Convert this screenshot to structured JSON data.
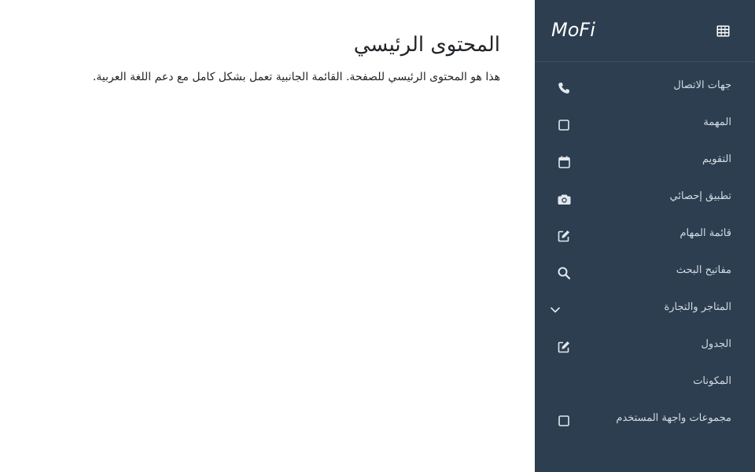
{
  "main": {
    "title": "المحتوى الرئيسي",
    "description": "هذا هو المحتوى الرئيسي للصفحة. القائمة الجانبية تعمل بشكل كامل مع دعم اللغة العربية."
  },
  "sidebar": {
    "logo": "MoFi",
    "header_icon": "grid-icon",
    "items": [
      {
        "label": "جهات الاتصال",
        "icon": "phone-icon"
      },
      {
        "label": "المهمة",
        "icon": "square-icon"
      },
      {
        "label": "التقويم",
        "icon": "calendar-icon"
      },
      {
        "label": "تطبيق إحصائي",
        "icon": "camera-icon"
      },
      {
        "label": "قائمة المهام",
        "icon": "edit-icon"
      },
      {
        "label": "مفاتيح البحث",
        "icon": "search-icon"
      },
      {
        "label": "المتاجر والتجارة",
        "icon": "chevron-down-icon"
      },
      {
        "label": "الجدول",
        "icon": "edit-icon"
      },
      {
        "label": "المكونات",
        "icon": ""
      },
      {
        "label": "مجموعات واجهة المستخدم",
        "icon": "square-icon"
      }
    ]
  },
  "colors": {
    "sidebar_bg": "#2c3e50",
    "sidebar_text": "#d4dbe3",
    "main_bg": "#ffffff",
    "title_text": "#212529"
  }
}
